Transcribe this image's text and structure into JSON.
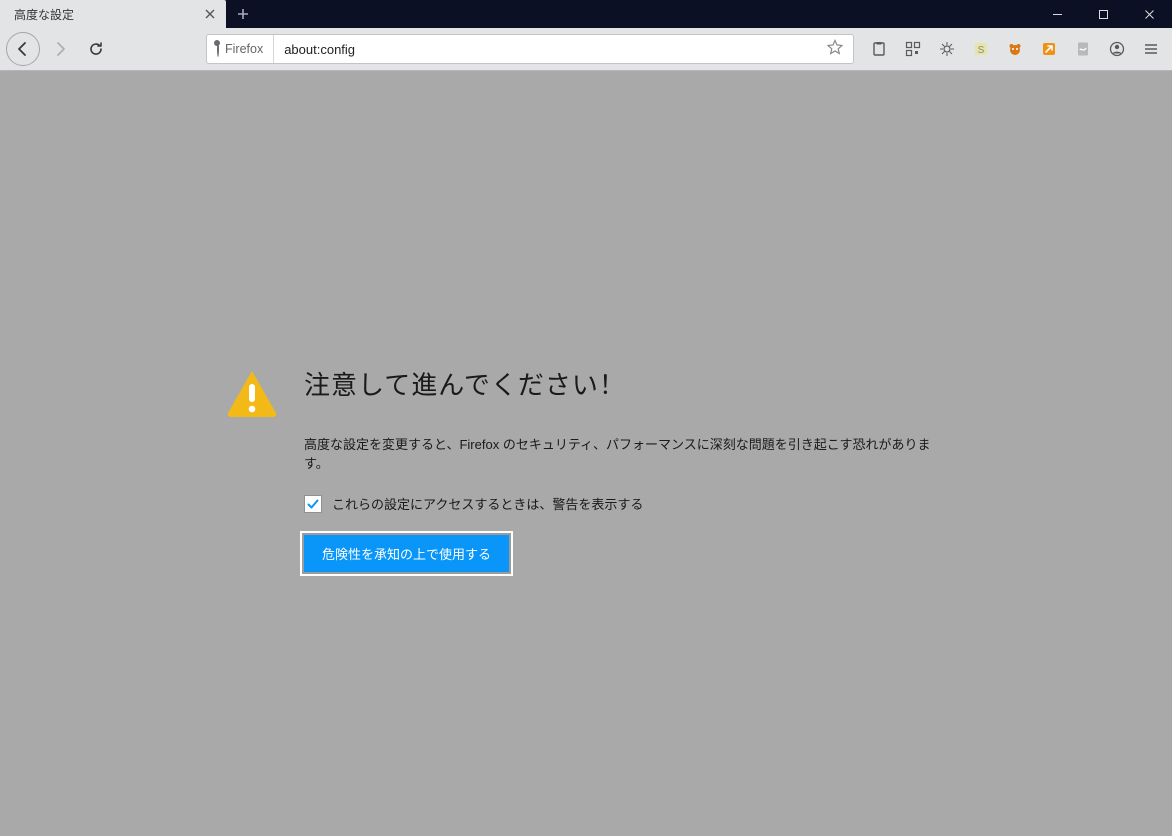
{
  "tab": {
    "title": "高度な設定"
  },
  "urlbar": {
    "identity_label": "Firefox",
    "url": "about:config"
  },
  "warning": {
    "title": "注意して進んでください！",
    "description": "高度な設定を変更すると、Firefox のセキュリティ、パフォーマンスに深刻な問題を引き起こす恐れがあります。",
    "checkbox_label": "これらの設定にアクセスするときは、警告を表示する",
    "checkbox_checked": true,
    "accept_button": "危険性を承知の上で使用する"
  }
}
